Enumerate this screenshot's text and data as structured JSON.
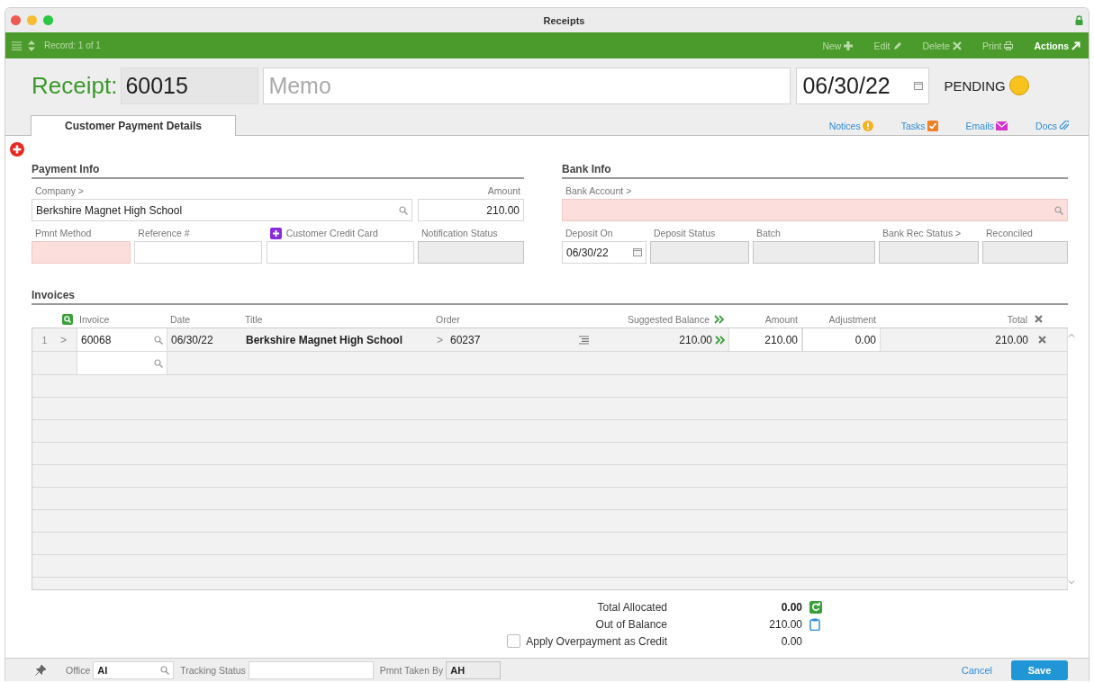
{
  "window": {
    "title": "Receipts"
  },
  "toolbar": {
    "record": "Record: 1 of 1",
    "actions": [
      {
        "label": "New",
        "kind": "new",
        "disabled": true
      },
      {
        "label": "Edit",
        "kind": "edit",
        "disabled": true
      },
      {
        "label": "Delete",
        "kind": "delete",
        "disabled": true
      },
      {
        "label": "Print",
        "kind": "print",
        "disabled": true
      },
      {
        "label": "Actions",
        "kind": "actions",
        "disabled": false
      }
    ]
  },
  "header": {
    "label": "Receipt:",
    "number": "60015",
    "memo_placeholder": "Memo",
    "date": "06/30/22",
    "status": "PENDING"
  },
  "tabs": [
    {
      "label": "Customer Payment Details",
      "selected": true
    }
  ],
  "links": [
    {
      "label": "Notices",
      "kind": "notices"
    },
    {
      "label": "Tasks",
      "kind": "tasks"
    },
    {
      "label": "Emails",
      "kind": "emails"
    },
    {
      "label": "Docs",
      "kind": "docs"
    }
  ],
  "payment_info": {
    "title": "Payment Info",
    "fields": [
      {
        "label": "Company >",
        "value": "Berkshire Magnet High School",
        "kind": "lookup",
        "required": false,
        "readonly": false
      },
      {
        "label": "Amount",
        "value": "210.00",
        "kind": "number",
        "required": false,
        "readonly": false
      },
      {
        "label": "Pmnt Method",
        "kind": "text",
        "required": true,
        "readonly": false
      },
      {
        "label": "Reference #",
        "kind": "text",
        "required": false,
        "readonly": false
      },
      {
        "label": "Customer Credit Card",
        "kind": "card",
        "required": false,
        "readonly": false
      },
      {
        "label": "Notification Status",
        "kind": "text",
        "required": false,
        "readonly": true
      }
    ]
  },
  "bank_info": {
    "title": "Bank Info",
    "fields": [
      {
        "label": "Bank Account >",
        "kind": "lookup",
        "required": true,
        "readonly": false
      },
      {
        "label": "Deposit On",
        "value": "06/30/22",
        "kind": "date",
        "required": false,
        "readonly": false
      },
      {
        "label": "Deposit Status",
        "kind": "text",
        "required": false,
        "readonly": true
      },
      {
        "label": "Batch",
        "kind": "text",
        "required": false,
        "readonly": true
      },
      {
        "label": "Bank Rec Status >",
        "kind": "text",
        "required": false,
        "readonly": true
      },
      {
        "label": "Reconciled",
        "kind": "text",
        "required": false,
        "readonly": true
      }
    ]
  },
  "invoices": {
    "title": "Invoices",
    "columns": [
      "Invoice",
      "Date",
      "Title",
      "Order",
      "Suggested Balance",
      "Amount",
      "Adjustment",
      "Total"
    ],
    "rows": [
      {
        "row_number": "1",
        "expand": ">",
        "invoice": "60068",
        "date": "06/30/22",
        "title": "Berkshire Magnet High School",
        "order_link": ">",
        "order": "60237",
        "suggested_balance": "210.00",
        "amount": "210.00",
        "adjustment": "0.00",
        "total": "210.00"
      }
    ]
  },
  "totals": [
    {
      "label": "Total Allocated",
      "value": "0.00",
      "kind": "allocated"
    },
    {
      "label": "Out of Balance",
      "value": "210.00",
      "kind": "balance"
    },
    {
      "label": "Apply Overpayment as Credit",
      "value": "0.00",
      "kind": "checkbox",
      "checked": false
    }
  ],
  "footer": {
    "fields": [
      {
        "label": "Office",
        "value": "AI",
        "kind": "lookup",
        "required": false,
        "readonly": false
      },
      {
        "label": "Tracking Status",
        "kind": "text",
        "required": false,
        "readonly": false
      },
      {
        "label": "Pmnt Taken By",
        "value": "AH",
        "kind": "text",
        "required": false,
        "readonly": true
      }
    ],
    "buttons": [
      {
        "label": "Cancel",
        "kind": "link"
      },
      {
        "label": "Save",
        "kind": "primary"
      }
    ]
  }
}
